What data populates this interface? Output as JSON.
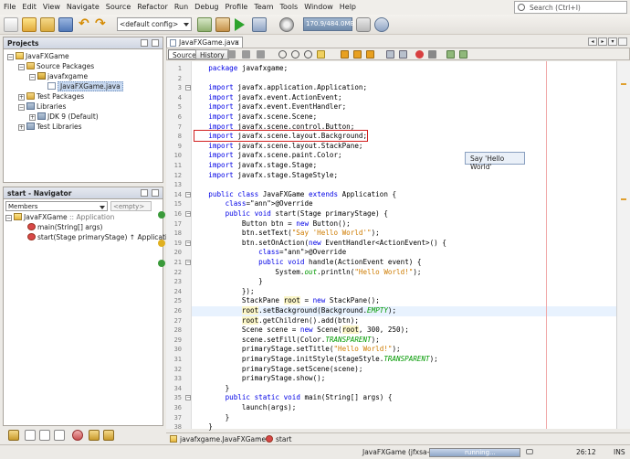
{
  "menu": [
    "File",
    "Edit",
    "View",
    "Navigate",
    "Source",
    "Refactor",
    "Run",
    "Debug",
    "Profile",
    "Team",
    "Tools",
    "Window",
    "Help"
  ],
  "search": {
    "placeholder": "Search (Ctrl+I)"
  },
  "toolbar": {
    "config": "<default config>",
    "memory": "170.9/484.0MB"
  },
  "projects": {
    "title": "Projects",
    "items": {
      "root": "JavaFXGame",
      "src": "Source Packages",
      "pkg": "javafxgame",
      "file": "JavaFXGame.java",
      "test_pkgs": "Test Packages",
      "libs": "Libraries",
      "jdk": "JDK 9 (Default)",
      "test_libs": "Test Libraries"
    }
  },
  "navigator": {
    "title": "start - Navigator",
    "filter": "Members",
    "empty": "<empty>",
    "root_name": "JavaFXGame",
    "root_suffix": ":: Application",
    "main": "main(String[] args)",
    "start": "start(Stage primaryStage) ↑ Application"
  },
  "editor": {
    "tab": "JavaFXGame.java",
    "source_btn": "Source",
    "history_btn": "History",
    "tooltip": "Say 'Hello World'",
    "lines": [
      {
        "n": "1",
        "t": "    package javafxgame;"
      },
      {
        "n": "2",
        "t": ""
      },
      {
        "n": "3",
        "t": "    import javafx.application.Application;"
      },
      {
        "n": "4",
        "t": "    import javafx.event.ActionEvent;"
      },
      {
        "n": "5",
        "t": "    import javafx.event.EventHandler;"
      },
      {
        "n": "6",
        "t": "    import javafx.scene.Scene;"
      },
      {
        "n": "7",
        "t": "    import javafx.scene.control.Button;"
      },
      {
        "n": "8",
        "t": "    import javafx.scene.layout.Background;"
      },
      {
        "n": "9",
        "t": "    import javafx.scene.layout.StackPane;"
      },
      {
        "n": "10",
        "t": "    import javafx.scene.paint.Color;"
      },
      {
        "n": "11",
        "t": "    import javafx.stage.Stage;"
      },
      {
        "n": "12",
        "t": "    import javafx.stage.StageStyle;"
      },
      {
        "n": "13",
        "t": ""
      },
      {
        "n": "14",
        "t": "    public class JavaFXGame extends Application {"
      },
      {
        "n": "15",
        "t": "        @Override"
      },
      {
        "n": "16",
        "t": "        public void start(Stage primaryStage) {"
      },
      {
        "n": "17",
        "t": "            Button btn = new Button();"
      },
      {
        "n": "18",
        "t": "            btn.setText(\"Say 'Hello World'\");"
      },
      {
        "n": "19",
        "t": "            btn.setOnAction(new EventHandler<ActionEvent>() {"
      },
      {
        "n": "20",
        "t": "                @Override"
      },
      {
        "n": "21",
        "t": "                public void handle(ActionEvent event) {"
      },
      {
        "n": "22",
        "t": "                    System.out.println(\"Hello World!\");"
      },
      {
        "n": "23",
        "t": "                }"
      },
      {
        "n": "24",
        "t": "            });"
      },
      {
        "n": "25",
        "t": "            StackPane root = new StackPane();"
      },
      {
        "n": "26",
        "t": "            root.setBackground(Background.EMPTY);"
      },
      {
        "n": "27",
        "t": "            root.getChildren().add(btn);"
      },
      {
        "n": "28",
        "t": "            Scene scene = new Scene(root, 300, 250);"
      },
      {
        "n": "29",
        "t": "            scene.setFill(Color.TRANSPARENT);"
      },
      {
        "n": "30",
        "t": "            primaryStage.setTitle(\"Hello World!\");"
      },
      {
        "n": "31",
        "t": "            primaryStage.initStyle(StageStyle.TRANSPARENT);"
      },
      {
        "n": "32",
        "t": "            primaryStage.setScene(scene);"
      },
      {
        "n": "33",
        "t": "            primaryStage.show();"
      },
      {
        "n": "34",
        "t": "        }"
      },
      {
        "n": "35",
        "t": "        public static void main(String[] args) {"
      },
      {
        "n": "36",
        "t": "            launch(args);"
      },
      {
        "n": "37",
        "t": "        }"
      },
      {
        "n": "38",
        "t": "    }"
      }
    ]
  },
  "breadcrumbs": {
    "a": "javafxgame.JavaFXGame",
    "b": "start"
  },
  "status": {
    "running_project": "JavaFXGame (jfxsa-run)",
    "progress": "running...",
    "position": "26:12",
    "mode": "INS"
  }
}
